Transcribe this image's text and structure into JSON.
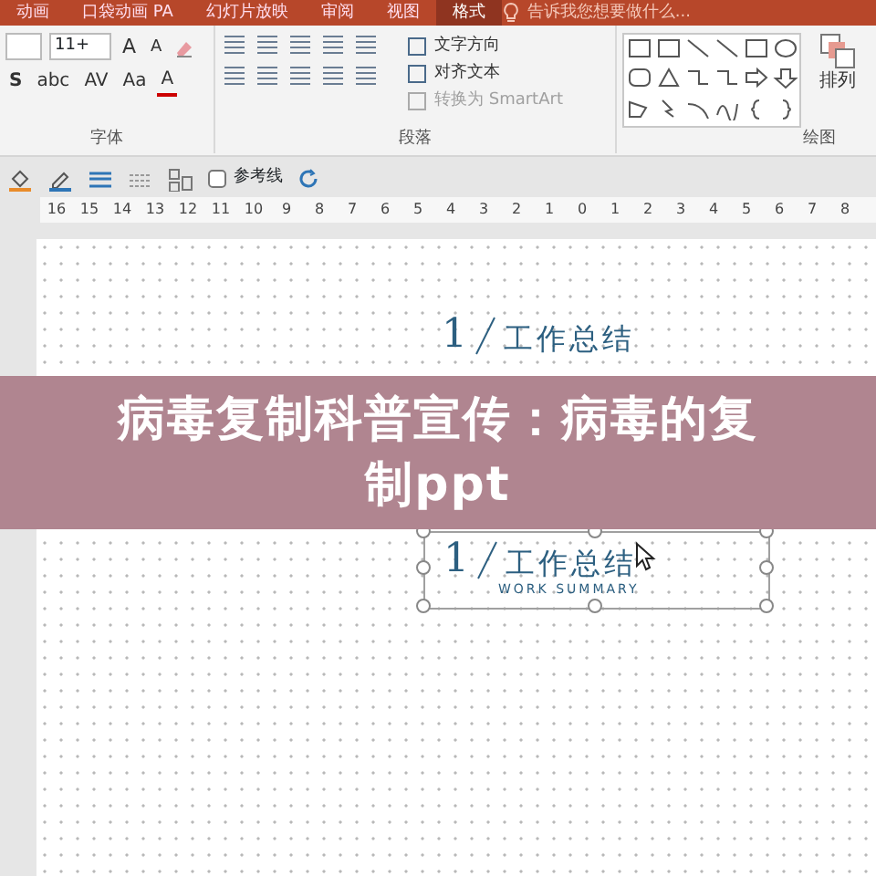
{
  "tabs": [
    {
      "label": "动画",
      "selected": false
    },
    {
      "label": "口袋动画 PA",
      "selected": false
    },
    {
      "label": "幻灯片放映",
      "selected": false
    },
    {
      "label": "审阅",
      "selected": false
    },
    {
      "label": "视图",
      "selected": false
    },
    {
      "label": "格式",
      "selected": true
    }
  ],
  "tell_me": {
    "placeholder": "告诉我您想要做什么..."
  },
  "font_group": {
    "label": "字体",
    "font_size": "11+",
    "row1_buttons": [
      "A",
      "A"
    ],
    "row2_buttons": [
      "S",
      "abc",
      "AV",
      "Aa",
      "A"
    ]
  },
  "paragraph_group": {
    "label": "段落",
    "text_commands": [
      {
        "label": "文字方向",
        "disabled": false
      },
      {
        "label": "对齐文本",
        "disabled": false
      },
      {
        "label": "转换为 SmartArt",
        "disabled": true
      }
    ]
  },
  "drawing_group": {
    "label": "绘图",
    "arrange": "排列"
  },
  "toolbar": {
    "guides": {
      "label": "参考线",
      "checked": false
    }
  },
  "ruler": [
    "16",
    "15",
    "14",
    "13",
    "12",
    "11",
    "10",
    "9",
    "8",
    "7",
    "6",
    "5",
    "4",
    "3",
    "2",
    "1",
    "0",
    "1",
    "2",
    "3",
    "4",
    "5",
    "6",
    "7",
    "8"
  ],
  "slide": {
    "items": [
      {
        "number": "1",
        "title": "工作总结",
        "selected": false
      },
      {
        "number": "1",
        "title": "工作总结",
        "subtitle": "WORK SUMMARY",
        "selected": true
      }
    ]
  },
  "banner": {
    "lines": [
      "病毒复制科普宣传：病毒的复",
      "制ppt"
    ]
  }
}
